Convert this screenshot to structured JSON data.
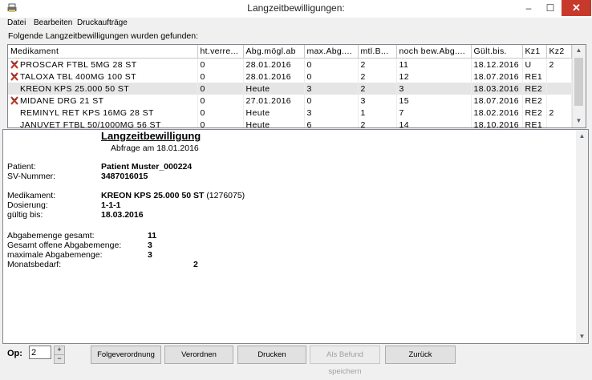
{
  "window": {
    "title": "Langzeitbewilligungen:",
    "min": "–",
    "max": "☐",
    "close": "✕"
  },
  "menu": [
    "Datei",
    "Bearbeiten",
    "Druckaufträge"
  ],
  "info_text": "Folgende Langzeitbewilligungen wurden gefunden:",
  "table": {
    "columns": [
      "Medikament",
      "ht.verre...",
      "Abg.mögl.ab",
      "max.Abg....",
      "mtl.B...",
      "noch bew.Abg....",
      "Gült.bis.",
      "Kz1",
      "Kz2"
    ],
    "rows": [
      {
        "icon": true,
        "cells": [
          "PROSCAR FTBL 5MG 28 ST",
          "0",
          "28.01.2016",
          "0",
          "2",
          "11",
          "18.12.2016",
          "U",
          "2"
        ]
      },
      {
        "icon": true,
        "cells": [
          "TALOXA TBL 400MG 100 ST",
          "0",
          "28.01.2016",
          "0",
          "2",
          "12",
          "18.07.2016",
          "RE1",
          ""
        ]
      },
      {
        "icon": false,
        "cells": [
          "KREON KPS 25.000 50 ST",
          "0",
          "Heute",
          "3",
          "2",
          "3",
          "18.03.2016",
          "RE2",
          ""
        ]
      },
      {
        "icon": true,
        "cells": [
          "MIDANE DRG 21 ST",
          "0",
          "27.01.2016",
          "0",
          "3",
          "15",
          "18.07.2016",
          "RE2",
          ""
        ]
      },
      {
        "icon": false,
        "cells": [
          "REMINYL RET KPS 16MG 28 ST",
          "0",
          "Heute",
          "3",
          "1",
          "7",
          "18.02.2016",
          "RE2",
          "2"
        ]
      },
      {
        "icon": false,
        "cells": [
          "JANUVET FTBL 50/1000MG 56 ST",
          "0",
          "Heute",
          "6",
          "2",
          "14",
          "18.10.2016",
          "RE1",
          ""
        ]
      }
    ]
  },
  "document": {
    "title": "Langzeitbewilligung",
    "subtitle": "Abfrage am 18.01.2016",
    "patient_label": "Patient:",
    "patient_value": "Patient Muster_000224",
    "sv_label": "SV-Nummer:",
    "sv_value": "3487016015",
    "med_label": "Medikament:",
    "med_value": "KREON KPS 25.000 50 ST",
    "med_code": "(1276075)",
    "dose_label": "Dosierung:",
    "dose_value": "1-1-1",
    "valid_label": "gültig bis:",
    "valid_value": "18.03.2016",
    "total_label": "Abgabemenge gesamt:",
    "total_value": "11",
    "open_label": "Gesamt offene Abgabemenge:",
    "open_value": "3",
    "max_label": "maximale Abgabemenge:",
    "max_value": "3",
    "month_label": "Monatsbedarf:",
    "month_value": "2"
  },
  "bottom": {
    "op_label": "Op:",
    "op_value": "2",
    "plus": "+",
    "minus": "−",
    "buttons": [
      "Folgeverordnung",
      "Verordnen",
      "Drucken",
      "Als Befund speichern",
      "Zurück"
    ]
  }
}
